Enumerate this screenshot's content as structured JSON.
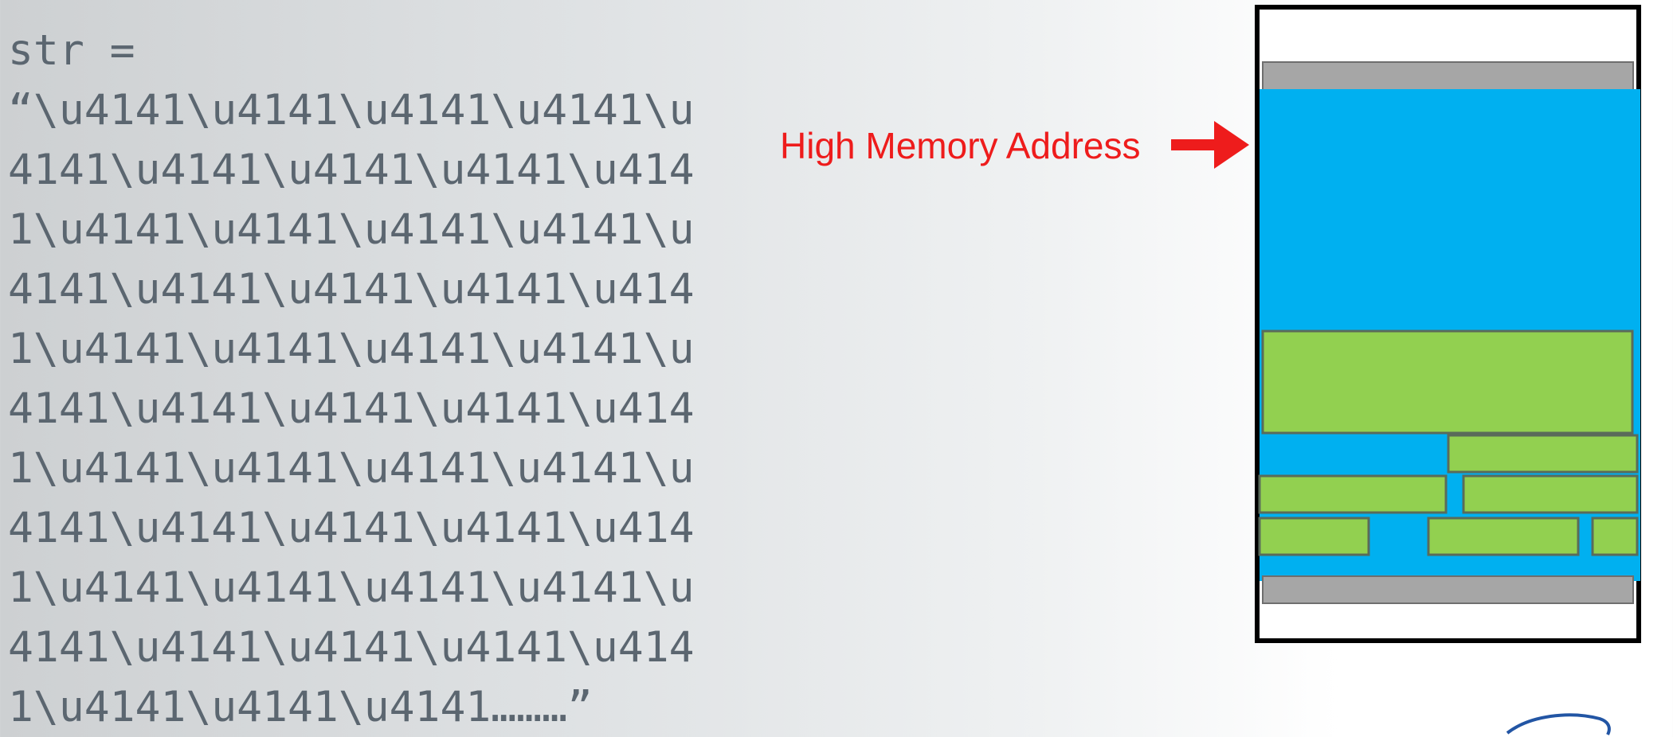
{
  "code_lines": [
    "str =",
    "“\\u4141\\u4141\\u4141\\u4141\\u",
    "4141\\u4141\\u4141\\u4141\\u414",
    "1\\u4141\\u4141\\u4141\\u4141\\u",
    "4141\\u4141\\u4141\\u4141\\u414",
    "1\\u4141\\u4141\\u4141\\u4141\\u",
    "4141\\u4141\\u4141\\u4141\\u414",
    "1\\u4141\\u4141\\u4141\\u4141\\u",
    "4141\\u4141\\u4141\\u4141\\u414",
    "1\\u4141\\u4141\\u4141\\u4141\\u",
    "4141\\u4141\\u4141\\u4141\\u414",
    "1\\u4141\\u4141\\u4141………”"
  ],
  "annotation": {
    "label": "High Memory Address",
    "color": "#ee1c1c"
  },
  "memory_diagram": {
    "border_color": "#000000",
    "header_footer_color": "#a6a6a6",
    "sprayed_fill_color": "#00b0f0",
    "block_fill_color": "#92d050",
    "block_outline_color": "#5a6b5a"
  },
  "logo": {
    "icon": "swoosh-logo",
    "color": "#2255a4"
  }
}
